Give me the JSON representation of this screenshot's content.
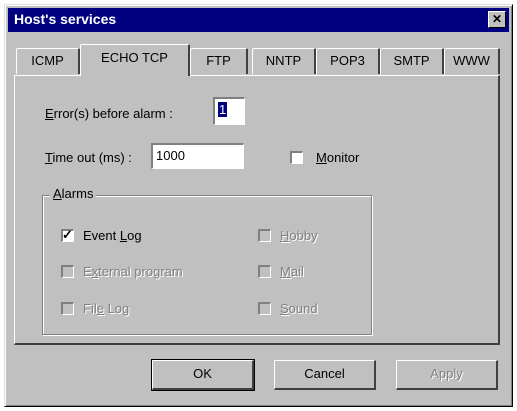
{
  "window": {
    "title": "Host's services",
    "close_glyph": "✕"
  },
  "tabs": [
    {
      "label": "ICMP"
    },
    {
      "label": "ECHO TCP"
    },
    {
      "label": "FTP"
    },
    {
      "label": "NNTP"
    },
    {
      "label": "POP3"
    },
    {
      "label": "SMTP"
    },
    {
      "label": "WWW"
    }
  ],
  "form": {
    "errors_label_u": "E",
    "errors_label_rest": "rror(s) before alarm :",
    "errors_value": "1",
    "timeout_label_u": "T",
    "timeout_label_rest": "ime out (ms) :",
    "timeout_value": "1000",
    "monitor_label_u": "M",
    "monitor_label_rest": "onitor"
  },
  "alarms": {
    "group_title_u": "A",
    "group_title_rest": "larms",
    "event_log_a": "Event ",
    "event_log_u": "L",
    "event_log_b": "og",
    "external_program_a": "E",
    "external_program_u": "x",
    "external_program_b": "ternal program",
    "file_log_a": "Fil",
    "file_log_u": "e",
    "file_log_b": " Log",
    "hobby_u": "H",
    "hobby_rest": "obby",
    "mail_u": "M",
    "mail_rest": "ail",
    "sound_u": "S",
    "sound_rest": "ound"
  },
  "buttons": {
    "ok": "OK",
    "cancel": "Cancel",
    "apply": "Apply"
  },
  "colors": {
    "title_bar": "#000080",
    "face": "#c0c0c0",
    "disabled_text": "#808080"
  }
}
